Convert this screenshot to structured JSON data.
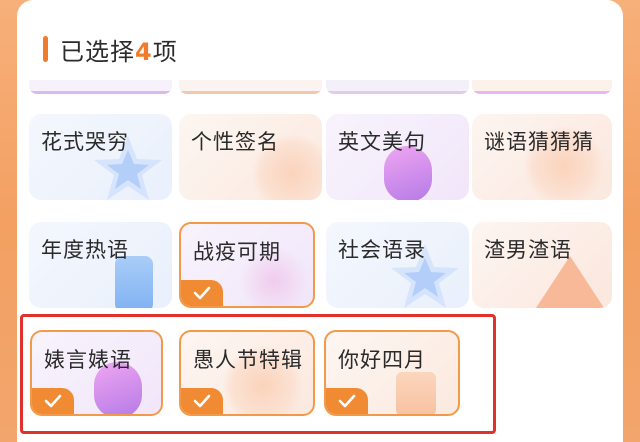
{
  "header": {
    "prefix": "已选择",
    "count": "4",
    "suffix": "项"
  },
  "grid": {
    "row1": [
      {
        "label": "花式哭穷",
        "selected": false
      },
      {
        "label": "个性签名",
        "selected": false
      },
      {
        "label": "英文美句",
        "selected": false
      },
      {
        "label": "谜语猜猜猜",
        "selected": false
      }
    ],
    "row2": [
      {
        "label": "年度热语",
        "selected": false
      },
      {
        "label": "战疫可期",
        "selected": true
      },
      {
        "label": "社会语录",
        "selected": false
      },
      {
        "label": "渣男渣语",
        "selected": false
      }
    ],
    "row3": [
      {
        "label": "婊言婊语",
        "selected": true
      },
      {
        "label": "愚人节特辑",
        "selected": true
      },
      {
        "label": "你好四月",
        "selected": true
      }
    ]
  },
  "colors": {
    "accent": "#f07b2b",
    "check_badge": "#f08b34",
    "selected_border": "#f29a4a",
    "highlight_box": "#e0312a"
  },
  "icons": {
    "check": "check-icon"
  }
}
